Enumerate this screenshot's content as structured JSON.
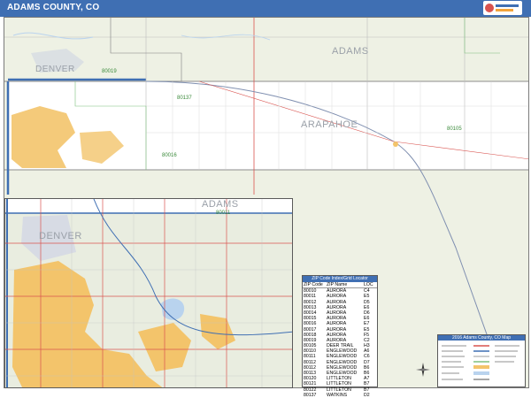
{
  "header": {
    "title": "ADAMS COUNTY, CO",
    "background_color": "#3f6fb3"
  },
  "map": {
    "county_labels": [
      "ADAMS",
      "ARAPAHOE",
      "DENVER"
    ],
    "zip_labels_main": [
      "80019",
      "80137",
      "80016",
      "80105"
    ],
    "zip_labels_inset": [
      "80011"
    ],
    "colors": {
      "land": "#eef1e4",
      "county_band": "#ffffff",
      "urban": "#f3c46b",
      "water": "#b9d3ee",
      "road_major": "#d9534f",
      "road_minor": "#bdbdbd",
      "highway": "#3f6fb3",
      "border": "#8c8c8c"
    }
  },
  "zip_table": {
    "title": "ZIP Code Index/Grid Locator",
    "columns": [
      "ZIP Code",
      "ZIP Name",
      "LOC"
    ],
    "rows": [
      [
        "80010",
        "AURORA",
        "C4"
      ],
      [
        "80011",
        "AURORA",
        "E5"
      ],
      [
        "80012",
        "AURORA",
        "D5"
      ],
      [
        "80013",
        "AURORA",
        "E6"
      ],
      [
        "80014",
        "AURORA",
        "D6"
      ],
      [
        "80015",
        "AURORA",
        "E6"
      ],
      [
        "80016",
        "AURORA",
        "E7"
      ],
      [
        "80017",
        "AURORA",
        "E5"
      ],
      [
        "80018",
        "AURORA",
        "F5"
      ],
      [
        "80019",
        "AURORA",
        "C2"
      ],
      [
        "80105",
        "DEER TRAIL",
        "H3"
      ],
      [
        "80110",
        "ENGLEWOOD",
        "A6"
      ],
      [
        "80111",
        "ENGLEWOOD",
        "C6"
      ],
      [
        "80112",
        "ENGLEWOOD",
        "D7"
      ],
      [
        "80112",
        "ENGLEWOOD",
        "B6"
      ],
      [
        "80113",
        "ENGLEWOOD",
        "B6"
      ],
      [
        "80120",
        "LITTLETON",
        "A7"
      ],
      [
        "80121",
        "LITTLETON",
        "B7"
      ],
      [
        "80122",
        "LITTLETON",
        "B7"
      ],
      [
        "80137",
        "WATKINS",
        "D2"
      ]
    ]
  },
  "legend": {
    "title": "2016 Adams County, CO Map"
  }
}
